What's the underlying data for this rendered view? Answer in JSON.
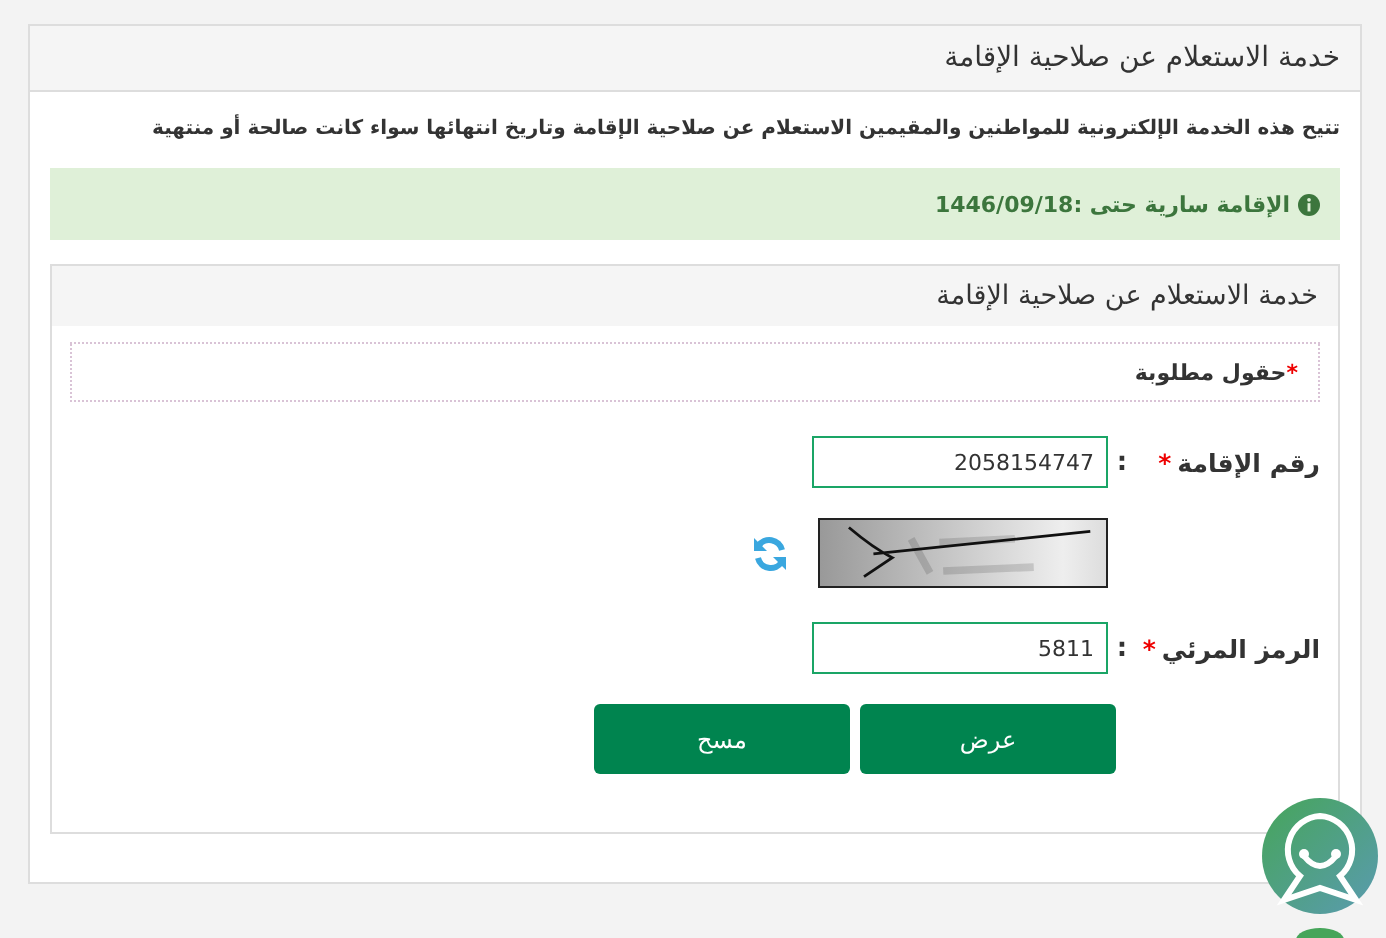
{
  "page_title": "خدمة الاستعلام عن صلاحية الإقامة",
  "description": "تتيح هذه الخدمة الإلكترونية للمواطنين والمقيمين الاستعلام عن صلاحية الإقامة وتاريخ انتهائها سواء كانت صالحة أو منتهية",
  "alert": {
    "text": "الإقامة سارية حتى :1446/09/18"
  },
  "form": {
    "title": "خدمة الاستعلام عن صلاحية الإقامة",
    "required_note": "حقول مطلوبة",
    "required_mark": "*",
    "fields": [
      {
        "kind": "text",
        "label": "رقم الإقامة",
        "required": true,
        "separator": ":",
        "value": "2058154747"
      },
      {
        "kind": "captcha"
      },
      {
        "kind": "text",
        "label": "الرمز المرئي",
        "required": true,
        "separator": ":",
        "value": "5811"
      }
    ],
    "buttons": [
      "عرض",
      "مسح"
    ]
  }
}
